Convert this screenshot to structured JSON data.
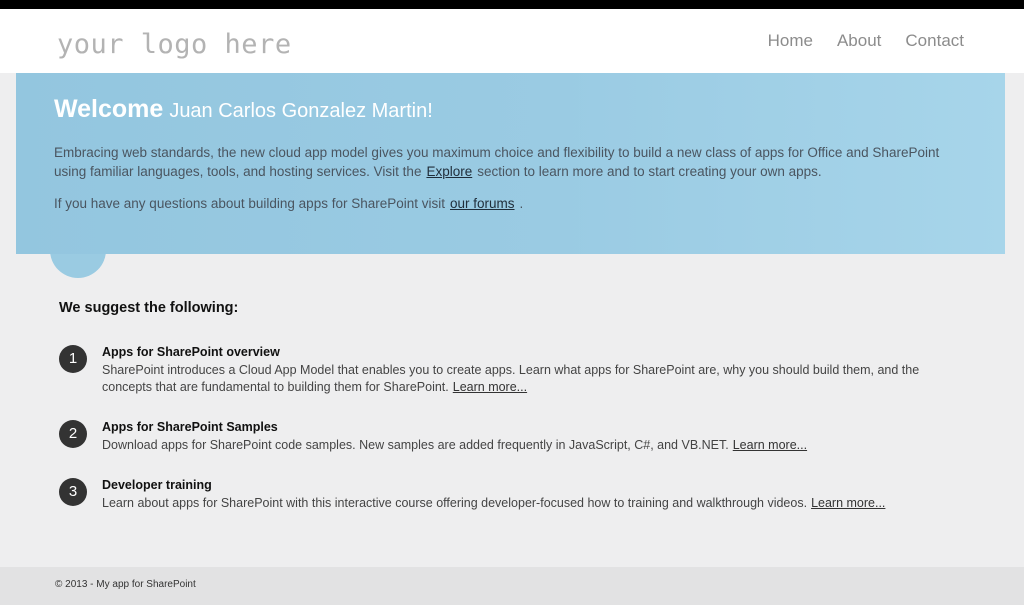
{
  "header": {
    "logo": "your logo here",
    "nav": [
      "Home",
      "About",
      "Contact"
    ]
  },
  "hero": {
    "welcome": "Welcome",
    "user": "Juan Carlos Gonzalez Martin!",
    "p1_a": "Embracing web standards, the new cloud app model gives you maximum choice and flexibility to build a new class of apps for Office and SharePoint using familiar languages, tools, and hosting services. Visit the",
    "p1_link": "Explore",
    "p1_b": "section to learn more and to start creating your own apps.",
    "p2_a": "If you have any questions about building apps for SharePoint visit",
    "p2_link": "our forums",
    "p2_b": "."
  },
  "suggestions": {
    "title": "We suggest the following:",
    "items": [
      {
        "num": "1",
        "title": "Apps for SharePoint overview",
        "desc": "SharePoint introduces a Cloud App Model that enables you to create apps. Learn what apps for SharePoint are, why you should build them, and the concepts that are fundamental to building them for SharePoint.",
        "link": "Learn more..."
      },
      {
        "num": "2",
        "title": "Apps for SharePoint Samples",
        "desc": "Download apps for SharePoint code samples. New samples are added frequently in JavaScript, C#, and VB.NET.",
        "link": "Learn more..."
      },
      {
        "num": "3",
        "title": "Developer training",
        "desc": "Learn about apps for SharePoint with this interactive course offering developer-focused how to training and walkthrough videos.",
        "link": "Learn more..."
      }
    ]
  },
  "footer": {
    "text": "© 2013 - My app for SharePoint"
  },
  "colors": {
    "hero_bg": "#9acbe3",
    "page_bg": "#eeeeef",
    "footer_bg": "#e2e2e3"
  }
}
